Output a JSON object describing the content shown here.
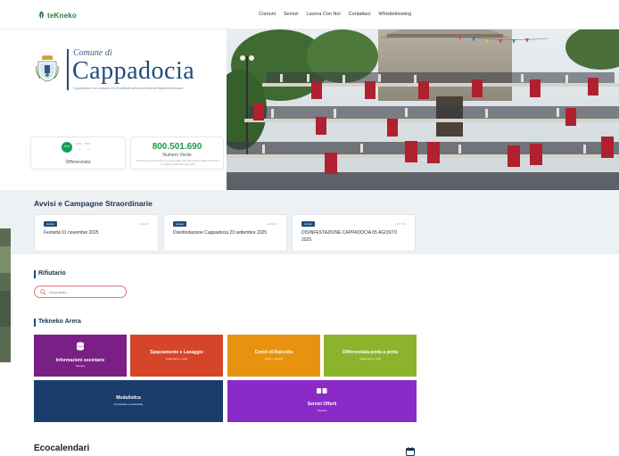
{
  "header": {
    "brand": "teKneko",
    "nav": [
      "Comuni",
      "Servizi",
      "Lavora Con Noi",
      "Contattaci",
      "Whistleblowing"
    ]
  },
  "hero": {
    "comune_di": "Comune di",
    "city": "Cappadocia",
    "subtitle": "Cappadocia è un comune di 526 abitanti della provincia dell'Aquila in Abruzzo",
    "gauge": {
      "value": "67%",
      "t1": "2021",
      "t2": "2022",
      "m1": "—",
      "m2": "—",
      "label": "Differenziata"
    },
    "numero_verde": {
      "number": "800.501.690",
      "label": "Numero Verde",
      "note1": "Servizio attivo dal lunedì al venerdì dalle 9:00 alle 13:00 e dalle 14:30 alle 17:00",
      "note2": "e il sabato dalle 9:00 alle 13:00"
    }
  },
  "avvisi": {
    "title": "Avvisi e Campagne Straordinarie",
    "items": [
      {
        "badge": "Avviso",
        "date": "29.10.25",
        "title": "Festività 01 novembre 2025"
      },
      {
        "badge": "Avviso",
        "date": "23.09.25",
        "title": "Disinfestazione Cappadocia 23 settembre 2025"
      },
      {
        "badge": "Avviso",
        "date": "29.07.25",
        "title": "DISINFESTAZIONE CAPPADOCIA 05 AGOSTO 2025"
      }
    ]
  },
  "rifiutario": {
    "title": "Rifiutario",
    "placeholder": "Cerca rifiuto..."
  },
  "area": {
    "title": "Tekneko Arera",
    "tiles": [
      {
        "title": "Informazioni societarie",
        "subtitle": "Tekneko",
        "color": "#7a1f85"
      },
      {
        "title": "Spazzamento e Lavaggio",
        "subtitle": "Calendario e orari",
        "color": "#d6452a"
      },
      {
        "title": "Centri di Raccolta",
        "subtitle": "Orari e Indirizzi",
        "color": "#e8930f"
      },
      {
        "title": "Differenziata porta a porta",
        "subtitle": "Calendario e orari",
        "color": "#8bb42c"
      },
      {
        "title": "Modulistica",
        "subtitle": "Accessibile e scaricabile",
        "color": "#1b3d6b"
      },
      {
        "title": "Servizi Offerti",
        "subtitle": "Tekneko",
        "color": "#8a2bc7"
      }
    ]
  },
  "eco": {
    "title": "Ecocalendari"
  }
}
